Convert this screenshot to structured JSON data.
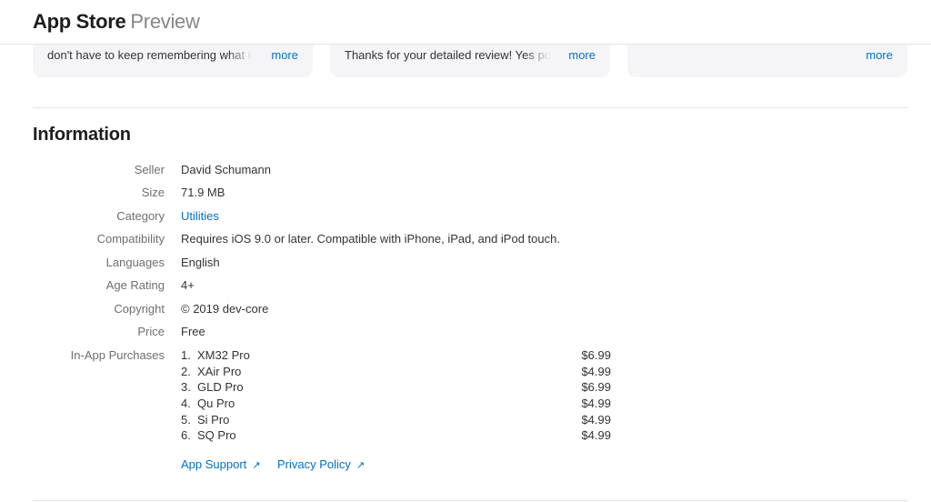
{
  "header": {
    "brand_main": "App Store",
    "brand_sub": "Preview"
  },
  "reviews": [
    {
      "text": "don't have to keep remembering what is",
      "more": "more"
    },
    {
      "text": "Thanks for your detailed review! Yes pow",
      "more": "more"
    },
    {
      "text": "",
      "more": "more"
    }
  ],
  "information": {
    "title": "Information",
    "rows": [
      {
        "label": "Seller",
        "value": "David Schumann"
      },
      {
        "label": "Size",
        "value": "71.9 MB"
      },
      {
        "label": "Category",
        "value": "Utilities"
      },
      {
        "label": "Compatibility",
        "value": "Requires iOS 9.0 or later. Compatible with iPhone, iPad, and iPod touch."
      },
      {
        "label": "Languages",
        "value": "English"
      },
      {
        "label": "Age Rating",
        "value": "4+"
      },
      {
        "label": "Copyright",
        "value": "© 2019 dev-core"
      },
      {
        "label": "Price",
        "value": "Free"
      }
    ],
    "iap_label": "In-App Purchases",
    "iap": [
      {
        "num": "1.",
        "name": "XM32 Pro",
        "price": "$6.99"
      },
      {
        "num": "2.",
        "name": "XAir Pro",
        "price": "$4.99"
      },
      {
        "num": "3.",
        "name": "GLD Pro",
        "price": "$6.99"
      },
      {
        "num": "4.",
        "name": "Qu Pro",
        "price": "$4.99"
      },
      {
        "num": "5.",
        "name": "Si Pro",
        "price": "$4.99"
      },
      {
        "num": "6.",
        "name": "SQ Pro",
        "price": "$4.99"
      }
    ]
  },
  "links": {
    "app_support": "App Support",
    "privacy_policy": "Privacy Policy",
    "arrow": "↗"
  },
  "colors": {
    "link": "#0070c9",
    "label": "#6e6e73",
    "text": "#333336",
    "card_bg": "#f5f5f7"
  }
}
